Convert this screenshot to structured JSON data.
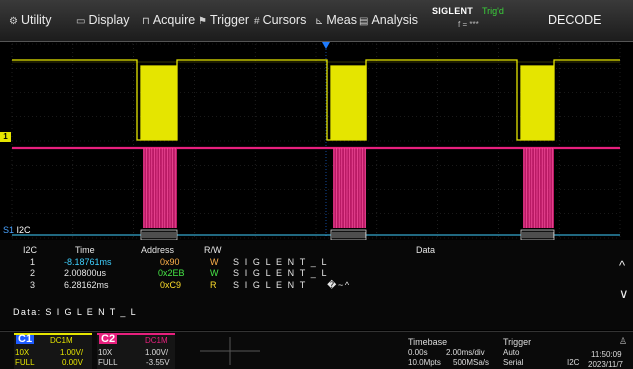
{
  "menu": {
    "utility": "Utility",
    "display": "Display",
    "acquire": "Acquire",
    "trigger": "Trigger",
    "cursors": "Cursors",
    "meas": "Meas",
    "analysis": "Analysis",
    "brand": "SIGLENT",
    "trig_state": "Trig'd",
    "freq": "f = ***",
    "decode": "DECODE"
  },
  "icons": {
    "utility": "gear-icon",
    "display": "monitor-icon",
    "acquire": "acquire-icon",
    "trigger": "flag-icon",
    "cursors": "hash-icon",
    "meas": "measure-icon",
    "analysis": "analysis-icon"
  },
  "colors": {
    "ch1": "#e5e500",
    "ch2": "#e8207e",
    "bus": "#3fd0ff",
    "trig_marker": "#1e7bff"
  },
  "markers": {
    "ch1": "1",
    "serial": "S1",
    "serial_proto": "I2C"
  },
  "table": {
    "headers": {
      "proto": "I2C",
      "time": "Time",
      "address": "Address",
      "rw": "R/W",
      "data": "Data"
    },
    "rows": [
      {
        "idx": "1",
        "time": "-8.18761ms",
        "address": "0x90",
        "rw": "W",
        "data": "S I G L E N T _ L"
      },
      {
        "idx": "2",
        "time": "2.00800us",
        "address": "0x2EB",
        "rw": "W",
        "data": "S I G L E N T _ L"
      },
      {
        "idx": "3",
        "time": "6.28162ms",
        "address": "0xC9",
        "rw": "R",
        "data": "S I G L E N T     �~^"
      }
    ],
    "decoded": "Data: S I G L E N T _ L",
    "scroll_up": "^",
    "scroll_down": "∨"
  },
  "ch1": {
    "name": "C1",
    "coupling": "DC1M",
    "probe": "10X",
    "scale": "1.00V/",
    "bw": "FULL",
    "offset": "0.00V"
  },
  "ch2": {
    "name": "C2",
    "coupling": "DC1M",
    "probe": "10X",
    "scale": "1.00V/",
    "bw": "FULL",
    "offset": "-3.55V"
  },
  "timebase": {
    "label": "Timebase",
    "delay": "0.00s",
    "scale": "2.00ms/div",
    "points": "10.0Mpts",
    "rate": "500MSa/s"
  },
  "trigger": {
    "label": "Trigger",
    "mode": "Auto",
    "type": "Serial",
    "source": "I2C"
  },
  "clock": {
    "time": "11:50:09",
    "date": "2023/11/7"
  },
  "bus_labels": [
    "▓▓▓▓▓",
    "▓▓▓▓▓",
    "▓▓▓▓▓",
    "▓▓▓▓▓"
  ]
}
